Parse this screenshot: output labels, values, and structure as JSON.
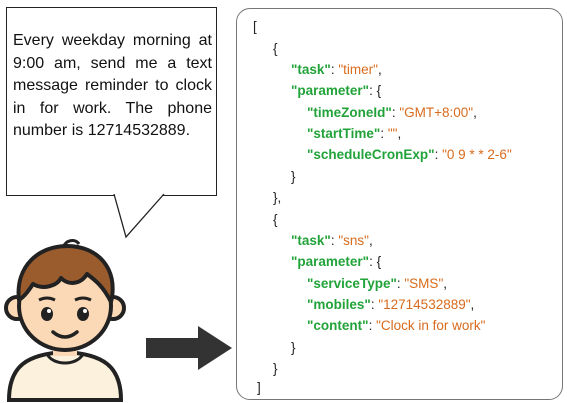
{
  "request": {
    "text": "Every weekday morning at 9:00 am, send me a text message reminder to clock in for work. The phone number is 12714532889."
  },
  "output": {
    "tasks": [
      {
        "task": "timer",
        "parameter": {
          "timeZoneId": "GMT+8:00",
          "startTime": "",
          "scheduleCronExp": "0 9 * * 2-6"
        }
      },
      {
        "task": "sns",
        "parameter": {
          "serviceType": "SMS",
          "mobiles": "12714532889",
          "content": "Clock in for work"
        }
      }
    ]
  },
  "colors": {
    "key": "#22a33a",
    "value": "#d86b1d",
    "panel_border": "#777777",
    "arrow": "#333333",
    "hair": "#9a5b2d",
    "skin": "#fcd9b6"
  },
  "icons": {
    "avatar": "cartoon-boy-avatar",
    "arrow": "right-arrow-icon"
  }
}
